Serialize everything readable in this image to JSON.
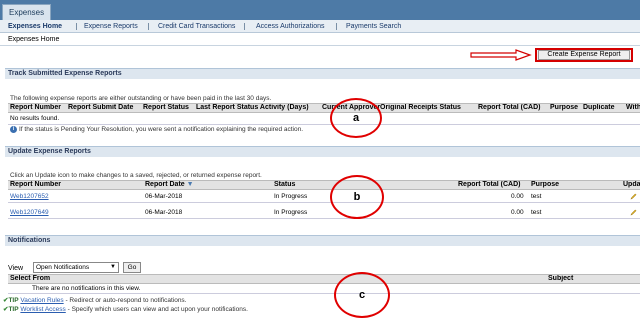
{
  "app_tab": "Expenses",
  "nav": {
    "items": [
      "Expenses Home",
      "Expense Reports",
      "Credit Card Transactions",
      "Access Authorizations",
      "Payments Search"
    ]
  },
  "breadcrumb": "Expenses Home",
  "create_button": "Create Expense Report",
  "track": {
    "title": "Track Submitted Expense Reports",
    "description": "The following expense reports are either outstanding or have been paid in the last 30 days.",
    "columns": [
      "Report Number",
      "Report Submit Date",
      "Report Status",
      "Last Report Status Activity (Days)",
      "Current Approver",
      "Original Receipts Status",
      "Report Total (CAD)",
      "Purpose",
      "Duplicate",
      "Withdraw"
    ],
    "empty_text": "No results found.",
    "info": "If the status is Pending Your Resolution, you were sent a notification explaining the required action."
  },
  "update": {
    "title": "Update Expense Reports",
    "description": "Click an Update icon to make changes to a saved, rejected, or returned expense report.",
    "columns": [
      "Report Number",
      "Report Date",
      "Status",
      "Report Total (CAD)",
      "Purpose",
      "Update"
    ],
    "rows": [
      {
        "number": "Web1207652",
        "date": "06-Mar-2018",
        "status": "In Progress",
        "total": "0.00",
        "purpose": "test"
      },
      {
        "number": "Web1207649",
        "date": "06-Mar-2018",
        "status": "In Progress",
        "total": "0.00",
        "purpose": "test"
      }
    ]
  },
  "notifications": {
    "title": "Notifications",
    "view_label": "View",
    "view_selected": "Open Notifications",
    "go_label": "Go",
    "columns": [
      "Select From",
      "Subject"
    ],
    "empty_text": "There are no notifications in this view.",
    "tips": [
      {
        "prefix": "TIP",
        "link": "Vacation Rules",
        "text": "- Redirect or auto-respond to notifications."
      },
      {
        "prefix": "TIP",
        "link": "Worklist Access",
        "text": "- Specify which users can view and act upon your notifications."
      }
    ]
  },
  "annotations": [
    "a",
    "b",
    "c"
  ],
  "colors": {
    "topbar": "#4d7aa6",
    "section_header": "#dde6ef",
    "annotation": "#e00000",
    "link": "#2a5db0"
  }
}
